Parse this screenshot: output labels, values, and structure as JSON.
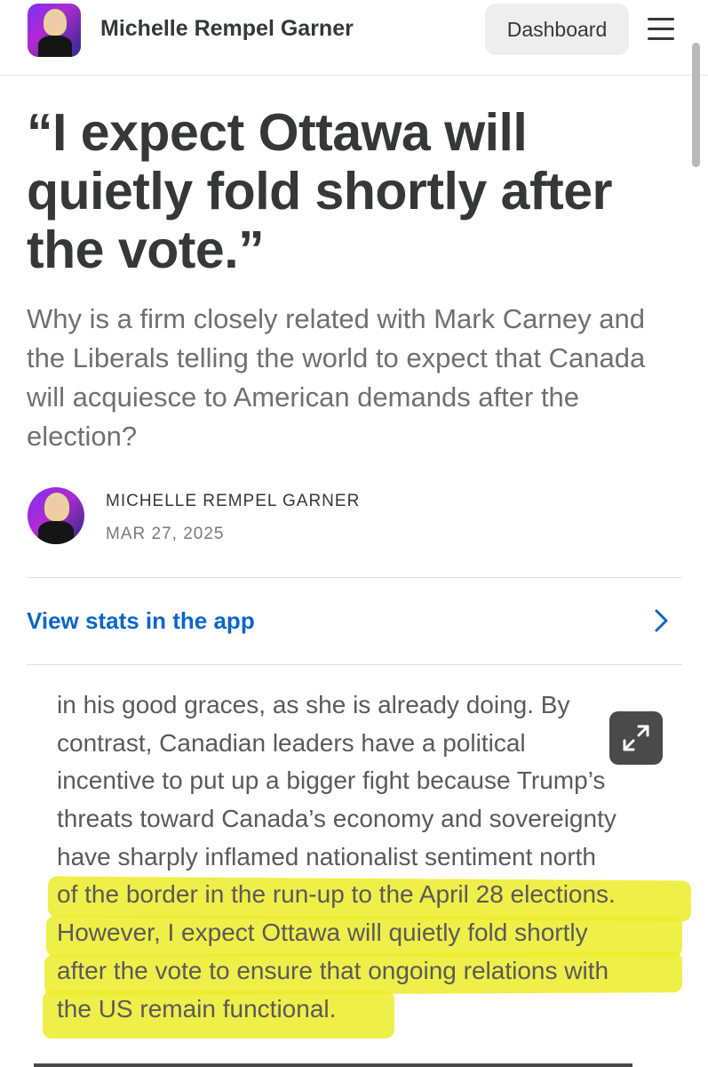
{
  "header": {
    "site_name": "Michelle Rempel Garner",
    "dashboard_label": "Dashboard",
    "logo_icon": "author-logo-icon",
    "menu_icon": "hamburger-menu-icon"
  },
  "post": {
    "title": "“I expect Ottawa will quietly fold shortly after the vote.”",
    "subtitle": "Why is a firm closely related with Mark Carney and the Liberals telling the world to expect that Canada will acquiesce to American demands after the election?",
    "author": "MICHELLE REMPEL GARNER",
    "date": "MAR 27, 2025"
  },
  "stats": {
    "link_label": "View stats in the app",
    "chevron_icon": "chevron-right-icon"
  },
  "excerpt": {
    "lines": [
      "in his good graces, as she is already doing. By",
      "contrast, Canadian leaders have a political",
      "incentive to put up a bigger fight because Trump’s",
      "threats toward Canada’s economy and sovereignty",
      "have sharply inflamed nationalist sentiment north",
      "of the border in the run-up to the April 28 elections.",
      "However, I expect Ottawa will quietly fold shortly",
      "after the vote to ensure that ongoing relations with",
      "the US remain functional."
    ],
    "expand_icon": "expand-icon",
    "highlight_color": "#ecec2a"
  },
  "colors": {
    "text": "#363737",
    "link": "#0a66c8",
    "muted": "#707070"
  }
}
